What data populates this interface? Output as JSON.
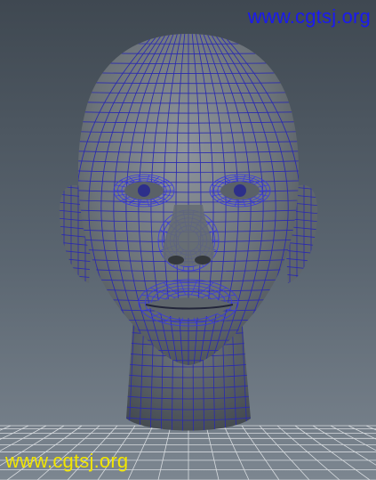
{
  "viewport": {
    "object": "head-wireframe-mesh",
    "wire_color": "#2a2ab0",
    "wire_color_dense": "#3a3ae0",
    "grid_color": "#d8dce0"
  },
  "watermarks": {
    "top": {
      "text": "www.cgtsj.org",
      "color": "#1a1af0"
    },
    "bottom": {
      "text": "www.cgtsj.org",
      "color": "#f2e600"
    }
  }
}
